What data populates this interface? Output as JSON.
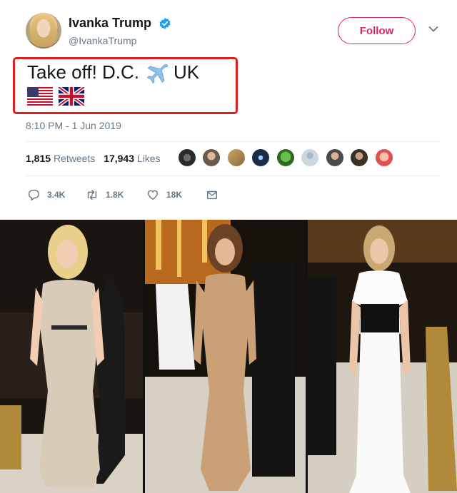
{
  "user": {
    "name": "Ivanka Trump",
    "handle": "@IvankaTrump",
    "verified": true
  },
  "follow_button": {
    "label": "Follow",
    "color": "#e0245e"
  },
  "menu": {
    "icon": "chevron-down-icon"
  },
  "tweet": {
    "text_before": "Take off! D.C.",
    "emoji_icon": "airplane-icon",
    "text_after": "UK",
    "flags": [
      "us-flag-icon",
      "uk-flag-icon"
    ],
    "highlight_color": "#e01b1b"
  },
  "timestamp": "8:10 PM - 1 Jun 2019",
  "stats": {
    "retweets_count": "1,815",
    "retweets_label": "Retweets",
    "likes_count": "17,943",
    "likes_label": "Likes"
  },
  "actions": {
    "replies": "3.4K",
    "retweets": "1.8K",
    "likes": "18K"
  },
  "colors": {
    "text": "#14171a",
    "muted": "#657786",
    "verified": "#1da1f2",
    "divider": "#e6ecf0"
  }
}
